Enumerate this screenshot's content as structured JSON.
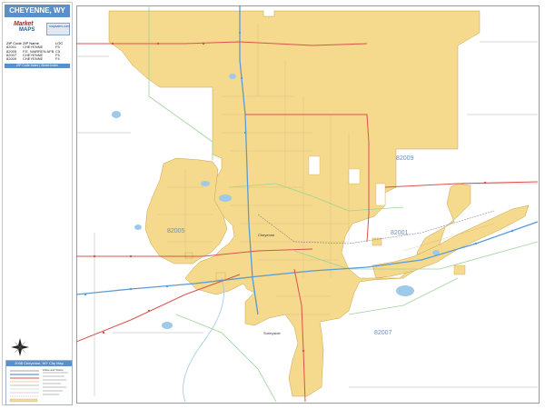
{
  "header": {
    "title": "CHEYENNE, WY"
  },
  "logo": {
    "line1": "Market",
    "line2": "MAPS",
    "badge": "mapsales.com"
  },
  "zip_table": {
    "columns": [
      "ZIP Code",
      "ZIP Name",
      "LOC"
    ],
    "rows": [
      [
        "82001",
        "CHEYENNE",
        "F5"
      ],
      [
        "82005",
        "F.E. WARREN AFB",
        "C5"
      ],
      [
        "82007",
        "CHEYENNE",
        "F5"
      ],
      [
        "82009",
        "CHEYENNE",
        "F4"
      ]
    ]
  },
  "index_bar": "ZIP Code Index | Street Index",
  "legend": {
    "title": "2008 Cheyenne, WY City Map",
    "subtitle": "Cities and Towns"
  },
  "map": {
    "zip_labels": [
      "82009",
      "82001",
      "82005",
      "82007"
    ],
    "city_label": "Cheyenne",
    "small_label": "Sunnyside"
  },
  "colors": {
    "city_fill": "#f5d98c",
    "city_stroke": "#c9a24a",
    "interstate": "#5b9bd5",
    "highway": "#d9534f",
    "zip_boundary": "#9fd39a",
    "water": "#9ec9e8",
    "title_bar": "#5b8fc8"
  },
  "icons": {
    "compass": "compass-rose-icon"
  }
}
